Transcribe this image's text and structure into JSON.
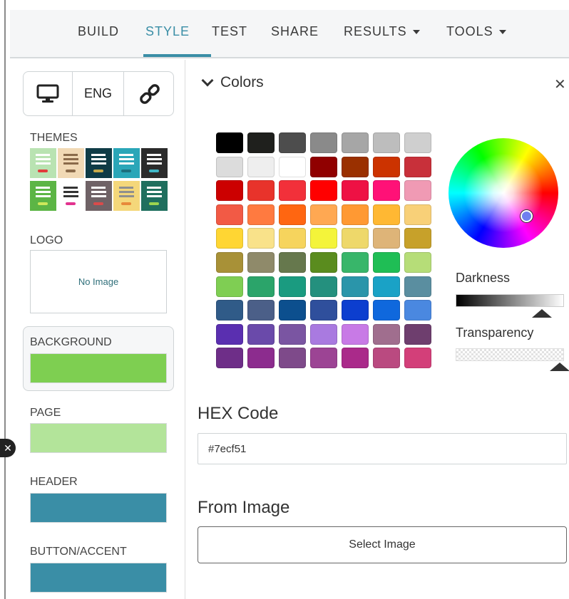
{
  "nav": {
    "build": "BUILD",
    "style": "STYLE",
    "test": "TEST",
    "share": "SHARE",
    "results": "RESULTS",
    "tools": "TOOLS"
  },
  "sidebar": {
    "device_icon": "desktop-monitor-icon",
    "language": "ENG",
    "link_icon": "link-icon",
    "themes_label": "THEMES",
    "themes": [
      {
        "bg": "#b9e3b2",
        "bar": "#ffffff",
        "pill": "#e23b3b"
      },
      {
        "bg": "#f1d9b5",
        "bar": "#8a6a4a",
        "pill": "#8a6a4a"
      },
      {
        "bg": "#0f3b46",
        "bar": "#ffffff",
        "pill": "#c7a94a"
      },
      {
        "bg": "#2aa6b8",
        "bar": "#ffffff",
        "pill": "#1d6f7e"
      },
      {
        "bg": "#2b2b2b",
        "bar": "#ffffff",
        "pill": "#3fb6c6"
      },
      {
        "bg": "#5cb545",
        "bar": "#ffffff",
        "pill": "#cde85a"
      },
      {
        "bg": "#ffffff",
        "bar": "#333333",
        "pill": "#e2338f"
      },
      {
        "bg": "#6f6266",
        "bar": "#ffffff",
        "pill": "#d94b4b"
      },
      {
        "bg": "#f4d77a",
        "bar": "#8f8f8f",
        "pill": "#e7893a"
      },
      {
        "bg": "#1f6f5e",
        "bar": "#ffffff",
        "pill": "#9bd34f"
      }
    ],
    "logo_label": "LOGO",
    "logo_placeholder": "No Image",
    "background_label": "BACKGROUND",
    "background_color": "#7ecf51",
    "page_label": "PAGE",
    "page_color": "#b3e49a",
    "header_label": "HEADER",
    "header_color": "#3a8ea6",
    "button_label": "BUTTON/ACCENT",
    "button_color": "#3a8ea6"
  },
  "colors_panel": {
    "title": "Colors",
    "palette": [
      [
        "#000000",
        "#1f201d",
        "#4d4d4d",
        "#8a8a8a",
        "#a6a6a6",
        "#bdbdbd",
        "#cfcfcf"
      ],
      [
        "#dcdcdc",
        "#eeeeee",
        "#ffffff",
        "#900000",
        "#9a3000",
        "#cc3300",
        "#c8303a"
      ],
      [
        "#cc0000",
        "#e8332b",
        "#f2303a",
        "#ff0000",
        "#ee1144",
        "#ff1177",
        "#f09ab4"
      ],
      [
        "#f25a45",
        "#ff7a40",
        "#ff6611",
        "#ffa852",
        "#ff9933",
        "#ffb833",
        "#f8d078"
      ],
      [
        "#ffd633",
        "#f9e28a",
        "#f6d45d",
        "#f4f43a",
        "#eed86a",
        "#deb478",
        "#c7a12a"
      ],
      [
        "#a89137",
        "#8f8a6a",
        "#66784d",
        "#5a8c1e",
        "#38b66a",
        "#1fbe55",
        "#b6dd78"
      ],
      [
        "#7fce53",
        "#2ba46a",
        "#1a9b80",
        "#24907e",
        "#2a95aa",
        "#1aa2c6",
        "#5a8ea0"
      ],
      [
        "#305b88",
        "#4b5f88",
        "#0c4f8e",
        "#2f4f9c",
        "#0c3ecf",
        "#0f68dd",
        "#4a88e0"
      ],
      [
        "#5a2fb0",
        "#6a4aaa",
        "#7a55a2",
        "#a97ae0",
        "#c87ae6",
        "#a06e8e",
        "#6e3e6e"
      ],
      [
        "#6e2e88",
        "#8c2c8e",
        "#7e4a8a",
        "#9c4494",
        "#aa2a8a",
        "#ba4a80",
        "#d33f79"
      ]
    ],
    "darkness_label": "Darkness",
    "transparency_label": "Transparency",
    "hex_label": "HEX Code",
    "hex_value": "#7ecf51",
    "from_image_label": "From Image",
    "select_image": "Select Image"
  }
}
